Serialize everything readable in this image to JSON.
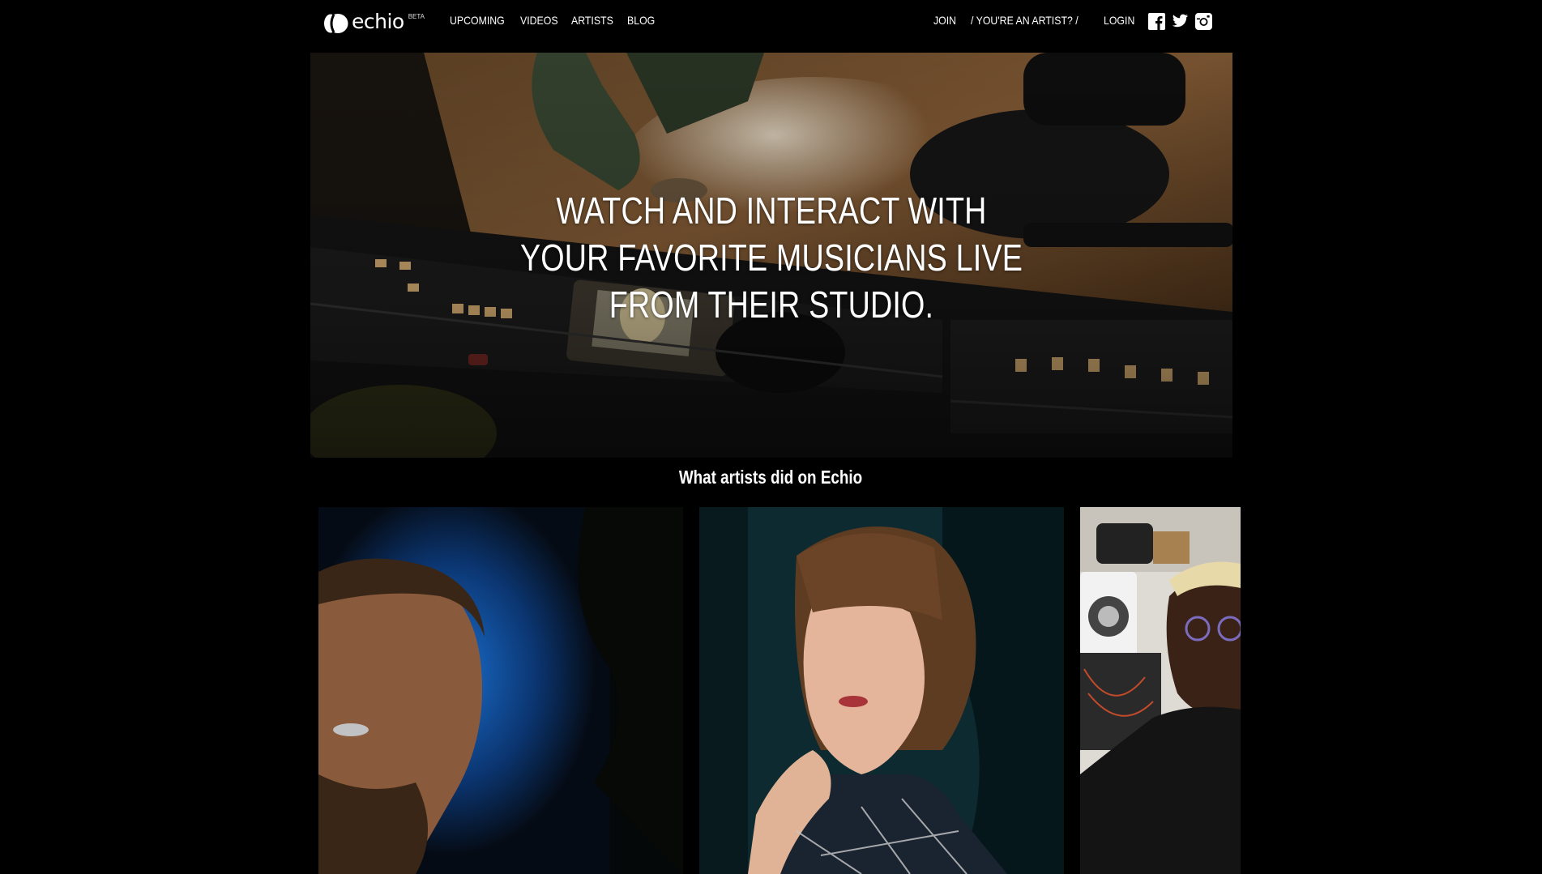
{
  "nav": {
    "logo": {
      "text": "echio",
      "badge": "BETA"
    },
    "links": [
      "UPCOMING",
      "VIDEOS",
      "ARTISTS",
      "BLOG"
    ],
    "join": "JOIN",
    "artist_prompt": "/ YOU'RE AN ARTIST? /",
    "login": "LOGIN",
    "social": [
      "facebook-icon",
      "twitter-icon",
      "instagram-icon"
    ]
  },
  "hero": {
    "title": "WATCH AND INTERACT WITH YOUR FAVORITE MUSICIANS LIVE FROM THEIR STUDIO."
  },
  "section": {
    "title": "What artists did on Echio"
  },
  "colors": {
    "background": "#000000",
    "text": "#ffffff"
  }
}
